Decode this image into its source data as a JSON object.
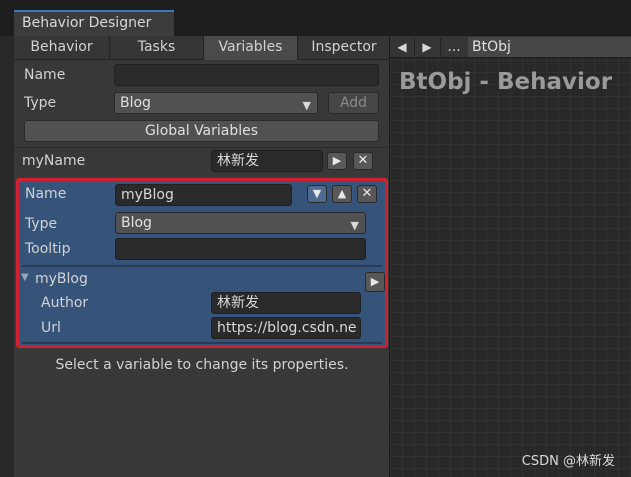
{
  "window": {
    "title": "Behavior Designer"
  },
  "tabs": [
    {
      "label": "Behavior",
      "active": false
    },
    {
      "label": "Tasks",
      "active": false
    },
    {
      "label": "Variables",
      "active": true
    },
    {
      "label": "Inspector",
      "active": false
    }
  ],
  "new_variable": {
    "name_label": "Name",
    "name_value": "",
    "type_label": "Type",
    "type_value": "Blog",
    "add_label": "Add",
    "global_label": "Global Variables"
  },
  "variable_row": {
    "label": "myName",
    "value": "林新发",
    "move_icon": "triangle-right-icon",
    "delete_icon": "close-icon"
  },
  "selected_variable": {
    "name_label": "Name",
    "name_value": "myBlog",
    "type_label": "Type",
    "type_value": "Blog",
    "tooltip_label": "Tooltip",
    "tooltip_value": "",
    "foldout_label": "myBlog",
    "expanded": true,
    "fields": [
      {
        "label": "Author",
        "value": "林新发"
      },
      {
        "label": "Url",
        "value": "https://blog.csdn.ne"
      }
    ],
    "highlight_color": "#d1202f"
  },
  "hint": "Select a variable to change its properties.",
  "graph": {
    "back_icon": "triangle-left-icon",
    "forward_icon": "triangle-right-icon",
    "more_label": "...",
    "object_value": "BtObj",
    "title": "BtObj - Behavior"
  },
  "watermark": "CSDN @林新发",
  "colors": {
    "accent": "#3a79bb",
    "selection": "#36547a"
  }
}
